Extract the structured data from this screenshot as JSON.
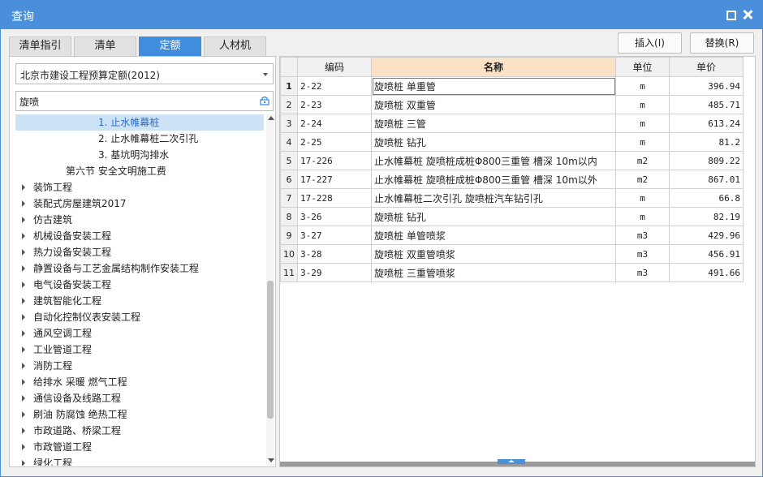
{
  "window": {
    "title": "查询"
  },
  "tabs": [
    {
      "label": "清单指引",
      "active": false
    },
    {
      "label": "清单",
      "active": false
    },
    {
      "label": "定额",
      "active": true
    },
    {
      "label": "人材机",
      "active": false
    }
  ],
  "actions": {
    "insert_label": "插入(I)",
    "replace_label": "替换(R)"
  },
  "left": {
    "library": {
      "selected": "北京市建设工程预算定额(2012)"
    },
    "search": {
      "value": "旋喷",
      "placeholder": ""
    },
    "tree": [
      {
        "label": "1. 止水帷幕桩",
        "level": 3,
        "expandable": false,
        "selected": true
      },
      {
        "label": "2. 止水帷幕桩二次引孔",
        "level": 3,
        "expandable": false,
        "selected": false
      },
      {
        "label": "3. 基坑明沟排水",
        "level": 3,
        "expandable": false,
        "selected": false
      },
      {
        "label": "第六节 安全文明施工费",
        "level": 2,
        "expandable": false,
        "selected": false
      },
      {
        "label": "装饰工程",
        "level": 1,
        "expandable": true,
        "selected": false
      },
      {
        "label": "装配式房屋建筑2017",
        "level": 1,
        "expandable": true,
        "selected": false
      },
      {
        "label": "仿古建筑",
        "level": 1,
        "expandable": true,
        "selected": false
      },
      {
        "label": "机械设备安装工程",
        "level": 1,
        "expandable": true,
        "selected": false
      },
      {
        "label": "热力设备安装工程",
        "level": 1,
        "expandable": true,
        "selected": false
      },
      {
        "label": "静置设备与工艺金属结构制作安装工程",
        "level": 1,
        "expandable": true,
        "selected": false
      },
      {
        "label": "电气设备安装工程",
        "level": 1,
        "expandable": true,
        "selected": false
      },
      {
        "label": "建筑智能化工程",
        "level": 1,
        "expandable": true,
        "selected": false
      },
      {
        "label": "自动化控制仪表安装工程",
        "level": 1,
        "expandable": true,
        "selected": false
      },
      {
        "label": "通风空调工程",
        "level": 1,
        "expandable": true,
        "selected": false
      },
      {
        "label": "工业管道工程",
        "level": 1,
        "expandable": true,
        "selected": false
      },
      {
        "label": "消防工程",
        "level": 1,
        "expandable": true,
        "selected": false
      },
      {
        "label": "给排水 采暖 燃气工程",
        "level": 1,
        "expandable": true,
        "selected": false
      },
      {
        "label": "通信设备及线路工程",
        "level": 1,
        "expandable": true,
        "selected": false
      },
      {
        "label": "刷油 防腐蚀 绝热工程",
        "level": 1,
        "expandable": true,
        "selected": false
      },
      {
        "label": "市政道路、桥梁工程",
        "level": 1,
        "expandable": true,
        "selected": false
      },
      {
        "label": "市政管道工程",
        "level": 1,
        "expandable": true,
        "selected": false
      },
      {
        "label": "绿化工程",
        "level": 1,
        "expandable": true,
        "selected": false
      }
    ]
  },
  "grid": {
    "headers": {
      "code": "编码",
      "name": "名称",
      "unit": "单位",
      "price": "单价"
    },
    "rows": [
      {
        "idx": "1",
        "code": "2-22",
        "name": "旋喷桩 单重管",
        "unit": "m",
        "price": "396.94"
      },
      {
        "idx": "2",
        "code": "2-23",
        "name": "旋喷桩 双重管",
        "unit": "m",
        "price": "485.71"
      },
      {
        "idx": "3",
        "code": "2-24",
        "name": "旋喷桩 三管",
        "unit": "m",
        "price": "613.24"
      },
      {
        "idx": "4",
        "code": "2-25",
        "name": "旋喷桩 钻孔",
        "unit": "m",
        "price": "81.2"
      },
      {
        "idx": "5",
        "code": "17-226",
        "name": "止水帷幕桩 旋喷桩成桩Φ800三重管 槽深 10m以内",
        "unit": "m2",
        "price": "809.22"
      },
      {
        "idx": "6",
        "code": "17-227",
        "name": "止水帷幕桩 旋喷桩成桩Φ800三重管 槽深 10m以外",
        "unit": "m2",
        "price": "867.01"
      },
      {
        "idx": "7",
        "code": "17-228",
        "name": "止水帷幕桩二次引孔 旋喷桩汽车钻引孔",
        "unit": "m",
        "price": "66.8"
      },
      {
        "idx": "8",
        "code": "3-26",
        "name": "旋喷桩 钻孔",
        "unit": "m",
        "price": "82.19"
      },
      {
        "idx": "9",
        "code": "3-27",
        "name": "旋喷桩 单管喷浆",
        "unit": "m3",
        "price": "429.96"
      },
      {
        "idx": "10",
        "code": "3-28",
        "name": "旋喷桩 双重管喷浆",
        "unit": "m3",
        "price": "456.91"
      },
      {
        "idx": "11",
        "code": "3-29",
        "name": "旋喷桩 三重管喷浆",
        "unit": "m3",
        "price": "491.66"
      }
    ]
  },
  "colors": {
    "accent": "#4a8fd9",
    "tab_active": "#3f8ddc",
    "tree_selected_bg": "#cce2f7",
    "header_highlight": "#fbe2c6"
  }
}
